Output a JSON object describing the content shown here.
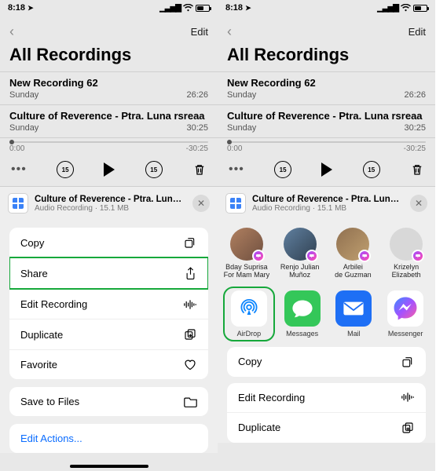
{
  "status": {
    "time": "8:18",
    "loc_arrow": "➤"
  },
  "nav": {
    "edit": "Edit"
  },
  "title": "All Recordings",
  "recordings": [
    {
      "name": "New Recording 62",
      "day": "Sunday",
      "dur": "26:26"
    },
    {
      "name": "Culture of Reverence - Ptra. Luna rsreaa",
      "day": "Sunday",
      "dur": "30:25"
    }
  ],
  "player": {
    "pos": "0:00",
    "neg": "-30:25",
    "skip": "15"
  },
  "share": {
    "title": "Culture of Reverence - Ptra. Luna rsreaa",
    "subtitle": "Audio Recording · 15.1 MB"
  },
  "leftMenu": {
    "copy": "Copy",
    "share": "Share",
    "editrec": "Edit Recording",
    "duplicate": "Duplicate",
    "favorite": "Favorite",
    "savefiles": "Save to Files",
    "editactions": "Edit Actions..."
  },
  "contacts": [
    {
      "line1": "Bday Suprisa",
      "line2": "For Mam Mary"
    },
    {
      "line1": "Renjo Julian",
      "line2": "Muñoz"
    },
    {
      "line1": "Arbilei",
      "line2": "de Guzman"
    },
    {
      "line1": "Krizelyn",
      "line2": "Elizabeth"
    }
  ],
  "apps": {
    "airdrop": "AirDrop",
    "messages": "Messages",
    "mail": "Mail",
    "messenger": "Messenger"
  },
  "rightMenu": {
    "copy": "Copy",
    "editrec": "Edit Recording",
    "duplicate": "Duplicate"
  }
}
